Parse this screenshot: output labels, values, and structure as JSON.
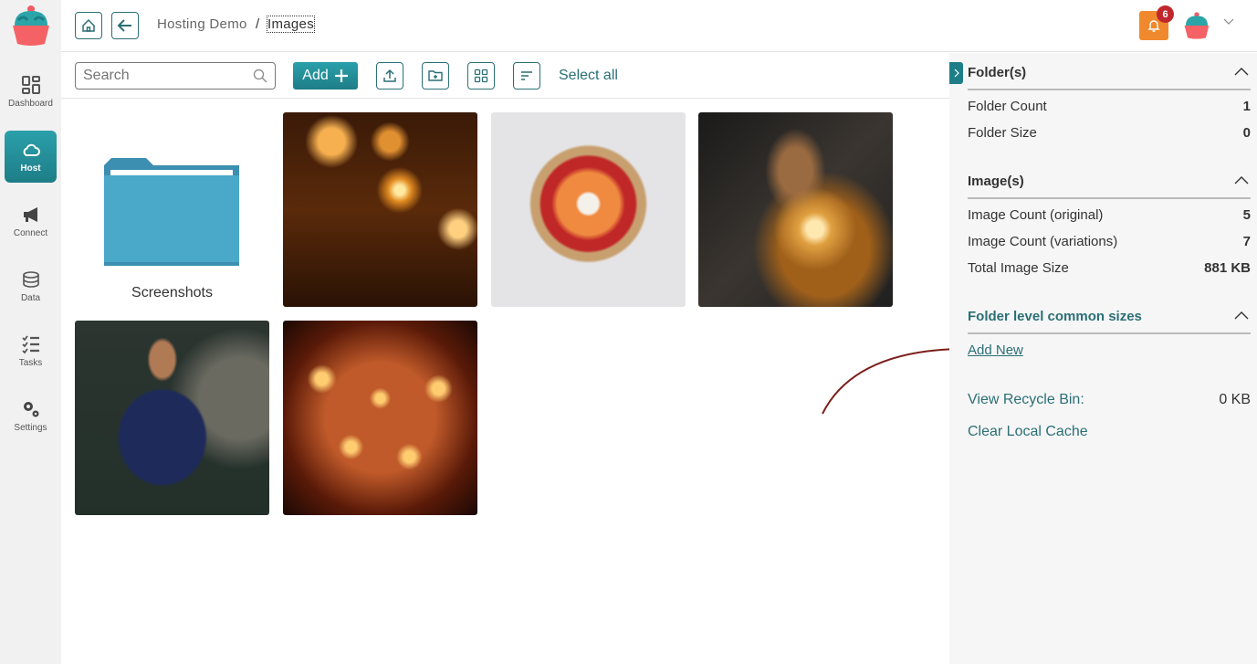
{
  "sidebar": {
    "logo": "cupcake-logo",
    "items": [
      {
        "label": "Dashboard",
        "icon": "dashboard-icon",
        "active": false
      },
      {
        "label": "Host",
        "icon": "cloud-icon",
        "active": true
      },
      {
        "label": "Connect",
        "icon": "megaphone-icon",
        "active": false
      },
      {
        "label": "Data",
        "icon": "database-icon",
        "active": false
      },
      {
        "label": "Tasks",
        "icon": "checklist-icon",
        "active": false
      },
      {
        "label": "Settings",
        "icon": "gears-icon",
        "active": false
      }
    ]
  },
  "header": {
    "breadcrumb": {
      "parent": "Hosting Demo",
      "separator": "/",
      "current": "Images"
    },
    "notifications_count": "6"
  },
  "toolbar": {
    "search_placeholder": "Search",
    "add_label": "Add",
    "select_all_label": "Select all"
  },
  "grid": {
    "folders": [
      {
        "name": "Screenshots"
      }
    ],
    "images": [
      {
        "subject": "diya candles bokeh"
      },
      {
        "subject": "flower bowl with candle"
      },
      {
        "subject": "woman with sparklers"
      },
      {
        "subject": "man with sparkler"
      },
      {
        "subject": "many lit diyas"
      }
    ]
  },
  "panel": {
    "folders": {
      "title": "Folder(s)",
      "rows": [
        {
          "label": "Folder Count",
          "value": "1"
        },
        {
          "label": "Folder Size",
          "value": "0"
        }
      ]
    },
    "images": {
      "title": "Image(s)",
      "rows": [
        {
          "label": "Image Count (original)",
          "value": "5"
        },
        {
          "label": "Image Count (variations)",
          "value": "7"
        },
        {
          "label": "Total Image Size",
          "value": "881 KB"
        }
      ]
    },
    "common_sizes": {
      "title": "Folder level common sizes",
      "add_new": "Add New"
    },
    "recycle_bin": {
      "label": "View Recycle Bin:",
      "value": "0 KB"
    },
    "clear_cache": "Clear Local Cache"
  },
  "colors": {
    "accent": "#1e7d87",
    "bell": "#f0892d",
    "badge": "#c0272d",
    "folder": "#4aa8c8",
    "annotation_arrow": "#7a1f1a"
  }
}
